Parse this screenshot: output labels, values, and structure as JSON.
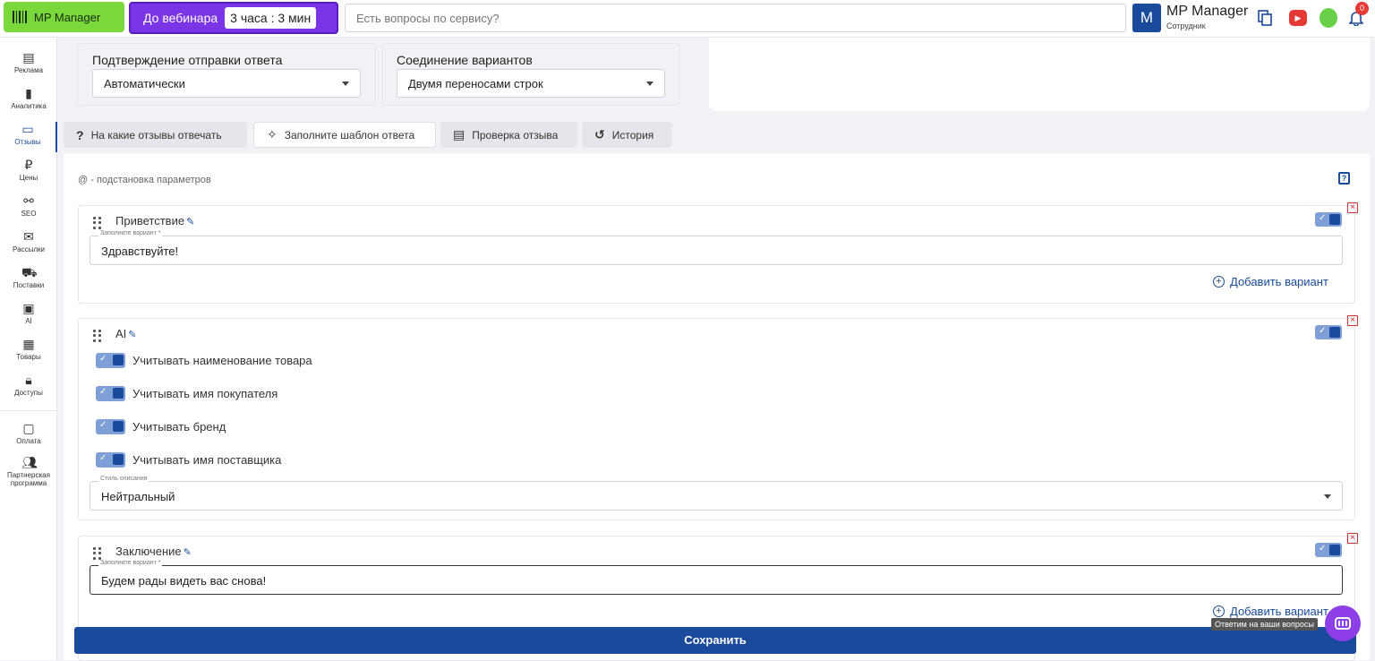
{
  "topbar": {
    "logo_label": "MP Manager",
    "webinar_label": "До вебинара",
    "webinar_timer": "3 часа : 3 мин",
    "search_placeholder": "Есть вопросы по сервису?",
    "user_initial": "M",
    "user_name": "MP Manager",
    "user_role": "Сотрудник",
    "notification_count": "0"
  },
  "sidebar": {
    "items": [
      {
        "label": "Реклама",
        "icon": "ad-icon"
      },
      {
        "label": "Аналитика",
        "icon": "chart-icon"
      },
      {
        "label": "Отзывы",
        "icon": "reviews-icon"
      },
      {
        "label": "Цены",
        "icon": "ruble-icon"
      },
      {
        "label": "SEO",
        "icon": "seo-icon"
      },
      {
        "label": "Рассылки",
        "icon": "mail-icon"
      },
      {
        "label": "Поставки",
        "icon": "truck-icon"
      },
      {
        "label": "AI",
        "icon": "chip-icon"
      },
      {
        "label": "Товары",
        "icon": "box-icon"
      },
      {
        "label": "Доступы",
        "icon": "lock-icon"
      },
      {
        "label": "Оплата",
        "icon": "wallet-icon"
      },
      {
        "label": "Партнерская программа",
        "icon": "partners-icon"
      }
    ]
  },
  "settings": {
    "confirm_title": "Подтверждение отправки ответа",
    "confirm_value": "Автоматически",
    "join_title": "Соединение вариантов",
    "join_value": "Двумя переносами строк"
  },
  "tabs": [
    {
      "label": "На какие отзывы отвечать",
      "icon": "question-icon"
    },
    {
      "label": "Заполните шаблон ответа",
      "icon": "magic-icon"
    },
    {
      "label": "Проверка отзыва",
      "icon": "comment-icon"
    },
    {
      "label": "История",
      "icon": "history-icon"
    }
  ],
  "main": {
    "hint": "@ - подстановка параметров",
    "greeting": {
      "title": "Приветствие",
      "field_label": "Заполните вариант *",
      "value": "Здравствуйте!",
      "add_label": "Добавить вариант"
    },
    "ai": {
      "title": "AI",
      "switches": [
        "Учитывать наименование товара",
        "Учитывать имя покупателя",
        "Учитывать бренд",
        "Учитывать имя поставщика"
      ],
      "style_label": "Стиль описания",
      "style_value": "Нейтральный"
    },
    "conclusion": {
      "title": "Заключение",
      "field_label": "Заполните вариант *",
      "value": "Будем рады видеть вас снова!",
      "add_label": "Добавить вариант"
    }
  },
  "save_label": "Сохранить",
  "chat_tooltip": "Ответим на ваши вопросы",
  "colors": {
    "accent": "#1a4a9b",
    "logo_green": "#7bd83a",
    "webinar_purple": "#7a35e6",
    "chat_purple": "#8e3ee6"
  }
}
